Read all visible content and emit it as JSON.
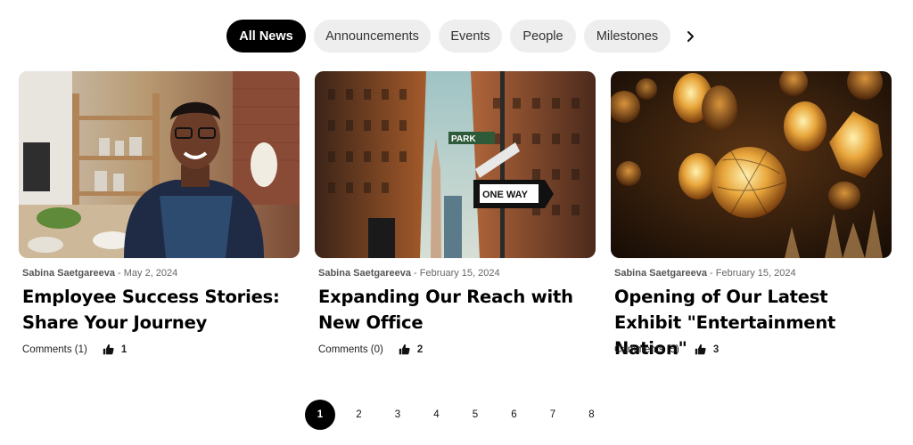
{
  "filters": {
    "tabs": [
      "All News",
      "Announcements",
      "Events",
      "People",
      "Milestones"
    ],
    "active": "All News"
  },
  "articles": [
    {
      "author": "Sabina Saetgareeva",
      "separator": " - ",
      "date": "May 2, 2024",
      "title": "Employee Success Stories: Share Your Journey",
      "comments": "Comments (1)",
      "likes": "1",
      "image": "smiling-barista-photo"
    },
    {
      "author": "Sabina Saetgareeva",
      "separator": " - ",
      "date": "February 15, 2024",
      "title": "Expanding Our Reach with New Office",
      "comments": "Comments (0)",
      "likes": "2",
      "image": "city-street-signs-photo",
      "street_signs": [
        "PARK",
        "ONE WAY"
      ]
    },
    {
      "author": "Sabina Saetgareeva",
      "separator": " - ",
      "date": "February 15, 2024",
      "title": "Opening of Our Latest Exhibit \"Entertainment Nation\"",
      "comments": "Comments (5)",
      "likes": "3",
      "image": "golden-lanterns-photo"
    }
  ],
  "pagination": {
    "pages": [
      "1",
      "2",
      "3",
      "4",
      "5",
      "6",
      "7",
      "8"
    ],
    "current": "1"
  },
  "colors": {
    "active_tab": "#000000",
    "inactive_tab": "#eeeeee",
    "text": "#111111"
  }
}
